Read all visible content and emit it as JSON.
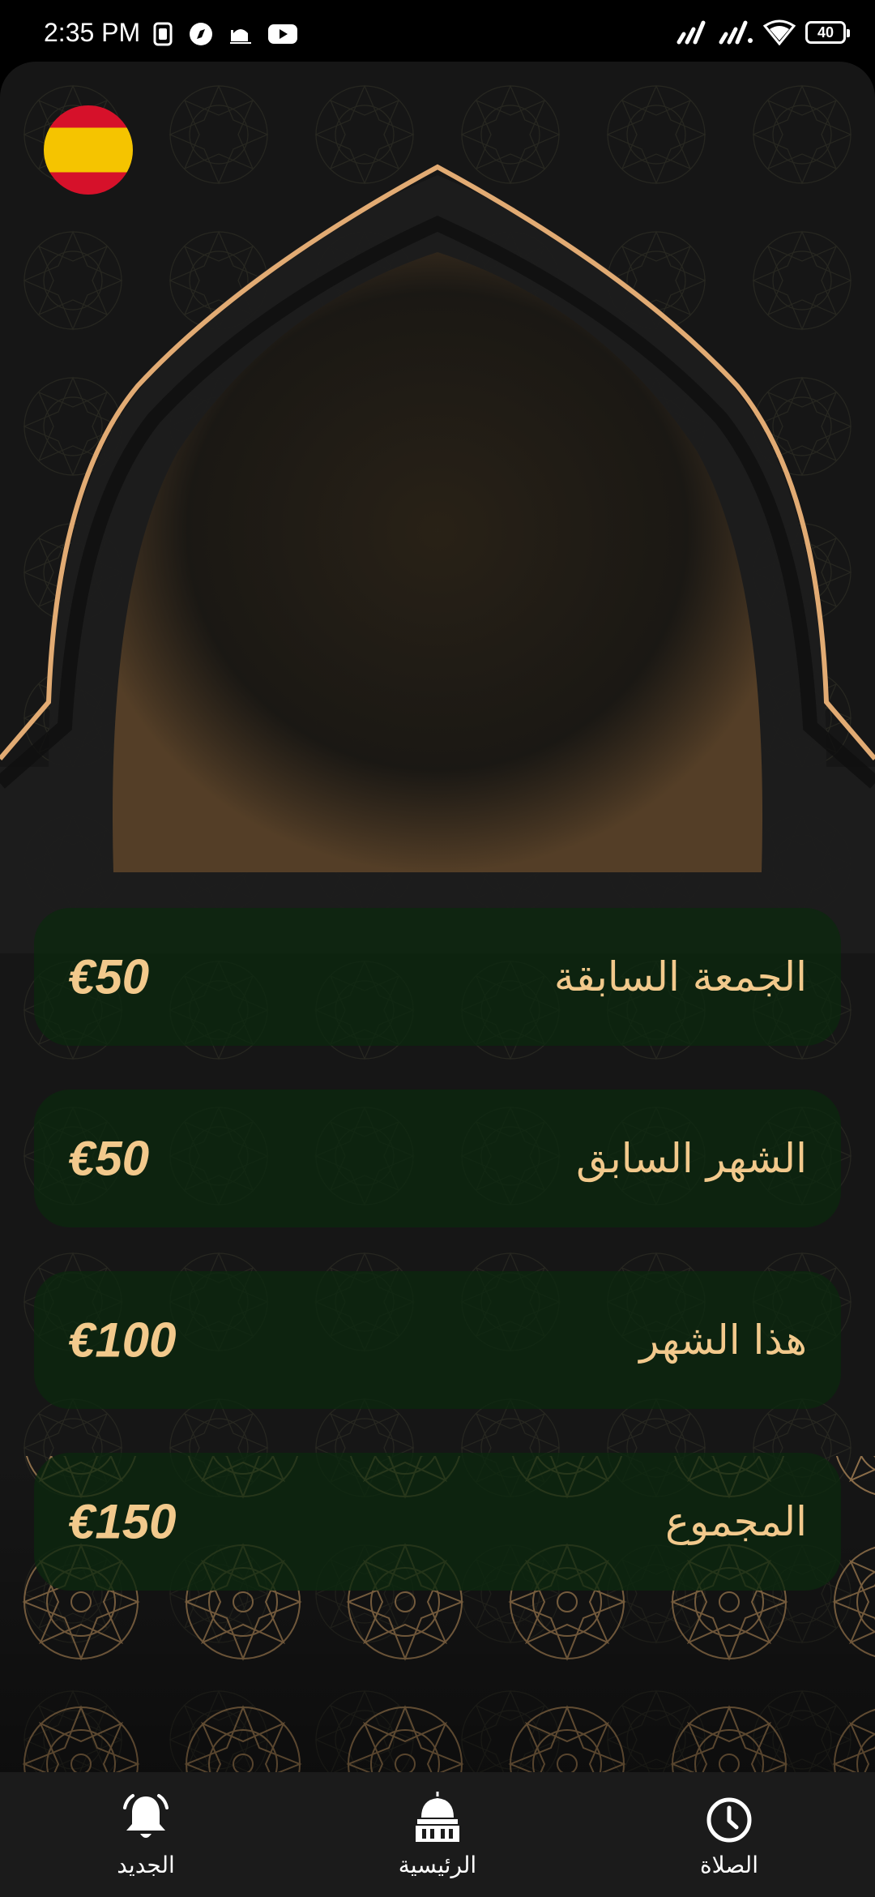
{
  "status_bar": {
    "time": "2:35 PM",
    "battery": "40"
  },
  "header": {
    "language_flag": "spain-flag-icon"
  },
  "stats": [
    {
      "label": "الجمعة السابقة",
      "value": "€50"
    },
    {
      "label": "الشهر السابق",
      "value": "€50"
    },
    {
      "label": "هذا الشهر",
      "value": "€100"
    },
    {
      "label": "المجموع",
      "value": "€150"
    }
  ],
  "bottom_nav": {
    "items": [
      {
        "label": "الجديد",
        "icon": "bell-icon"
      },
      {
        "label": "الرئيسية",
        "icon": "mosque-icon"
      },
      {
        "label": "الصلاة",
        "icon": "clock-icon"
      }
    ]
  },
  "colors": {
    "background": "#161616",
    "accent_gold": "#f2c98c",
    "card_green": "#0c280e",
    "arch_gold": "#e7b07a"
  }
}
